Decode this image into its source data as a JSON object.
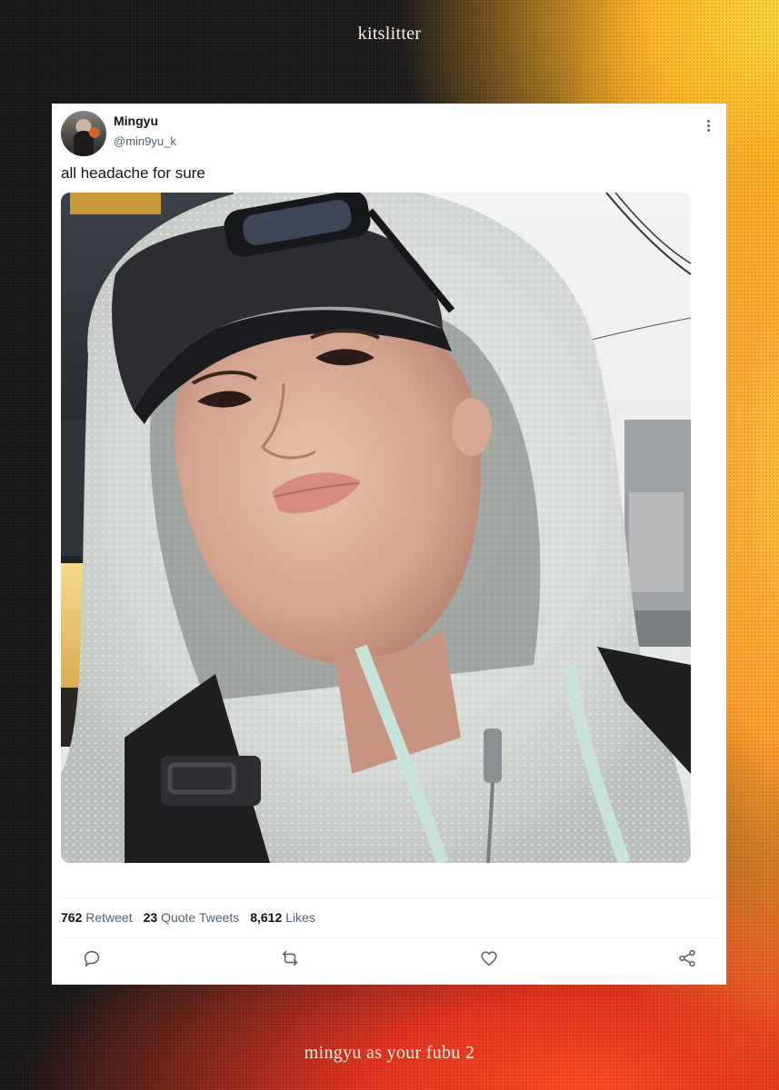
{
  "page": {
    "top_caption": "kitslitter",
    "bottom_caption": "mingyu as your fubu 2"
  },
  "tweet": {
    "display_name": "Mingyu",
    "handle": "@min9yu_k",
    "text": "all headache for sure",
    "more_icon": "more-vertical-icon",
    "photo_description_icon": "photo",
    "stats": {
      "retweets_count": "762",
      "retweets_label": "Retweet",
      "quotes_count": "23",
      "quotes_label": "Quote Tweets",
      "likes_count": "8,612",
      "likes_label": "Likes"
    },
    "actions": [
      {
        "name": "reply",
        "icon": "reply-icon"
      },
      {
        "name": "retweet",
        "icon": "retweet-icon"
      },
      {
        "name": "like",
        "icon": "heart-icon"
      },
      {
        "name": "share",
        "icon": "share-icon"
      }
    ]
  },
  "colors": {
    "text_primary": "#0f1419",
    "text_secondary": "#536471",
    "card_bg": "#ffffff",
    "caption_text": "#f4efe9"
  }
}
